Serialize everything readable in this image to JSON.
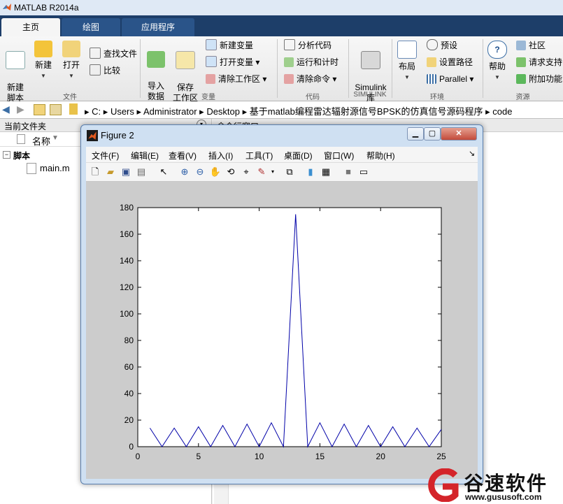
{
  "window": {
    "title": "MATLAB R2014a"
  },
  "tabs": [
    {
      "label": "主页",
      "active": true
    },
    {
      "label": "绘图",
      "active": false
    },
    {
      "label": "应用程序",
      "active": false
    }
  ],
  "ribbon": {
    "file": {
      "group": "文件",
      "new_script": "新建\n脚本",
      "new": "新建",
      "open": "打开",
      "find_files": "查找文件",
      "compare": "比较"
    },
    "variable": {
      "group": "变量",
      "import": "导入\n数据",
      "save_ws": "保存\n工作区",
      "new_var": "新建变量",
      "open_var": "打开变量",
      "clear_ws": "清除工作区"
    },
    "code": {
      "group": "代码",
      "analyze": "分析代码",
      "run_time": "运行和计时",
      "clear_cmd": "清除命令"
    },
    "simulink": {
      "group": "SIMULINK",
      "lib": "Simulink\n库"
    },
    "environment": {
      "group": "环境",
      "layout": "布局",
      "prefs": "预设",
      "set_path": "设置路径",
      "parallel": "Parallel"
    },
    "resources": {
      "group": "资源",
      "help": "帮助",
      "community": "社区",
      "request_support": "请求支持",
      "addons": "附加功能"
    }
  },
  "address": {
    "path": [
      "C:",
      "Users",
      "Administrator",
      "Desktop",
      "基于matlab编程雷达辐射源信号BPSK的仿真信号源码程序",
      "code"
    ]
  },
  "left_panel": {
    "title": "当前文件夹",
    "column_name": "名称",
    "group": "脚本",
    "file": "main.m"
  },
  "right_panel": {
    "title": "命令行窗口"
  },
  "figure": {
    "title": "Figure 2",
    "menu": [
      "文件(F)",
      "编辑(E)",
      "查看(V)",
      "插入(I)",
      "工具(T)",
      "桌面(D)",
      "窗口(W)",
      "帮助(H)"
    ]
  },
  "chart_data": {
    "type": "line",
    "title": "",
    "xlabel": "",
    "ylabel": "",
    "xlim": [
      0,
      25
    ],
    "ylim": [
      0,
      180
    ],
    "xticks": [
      0,
      5,
      10,
      15,
      20,
      25
    ],
    "yticks": [
      0,
      20,
      40,
      60,
      80,
      100,
      120,
      140,
      160,
      180
    ],
    "grid": false,
    "series": [
      {
        "color": "#0000a8",
        "x": [
          1,
          2,
          3,
          4,
          5,
          6,
          7,
          8,
          9,
          10,
          11,
          12,
          13,
          14,
          15,
          16,
          17,
          18,
          19,
          20,
          21,
          22,
          23,
          24,
          25
        ],
        "y": [
          14,
          0,
          14,
          0,
          15,
          0,
          16,
          0,
          17,
          0,
          18,
          0,
          175,
          0,
          18,
          0,
          17,
          0,
          16,
          0,
          15,
          0,
          14,
          0,
          13
        ]
      }
    ]
  },
  "watermark": {
    "brand": "谷速软件",
    "url": "www.gususoft.com"
  }
}
